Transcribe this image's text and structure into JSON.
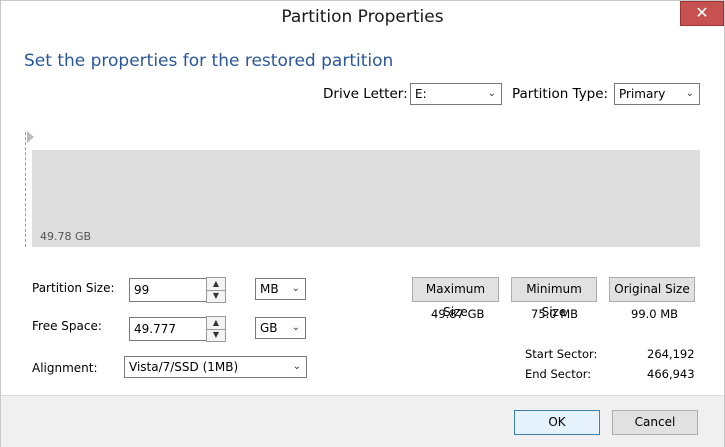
{
  "window": {
    "title": "Partition Properties",
    "close_glyph": "✕"
  },
  "heading": "Set the properties for the restored partition",
  "drive_letter": {
    "label": "Drive Letter:",
    "value": "E:"
  },
  "partition_type": {
    "label": "Partition Type:",
    "value": "Primary"
  },
  "disk_map": {
    "size_label": "49.78 GB"
  },
  "partition_size": {
    "label": "Partition Size:",
    "value": "99",
    "unit": "MB"
  },
  "free_space": {
    "label": "Free Space:",
    "value": "49.777",
    "unit": "GB"
  },
  "alignment": {
    "label": "Alignment:",
    "value": "Vista/7/SSD (1MB)"
  },
  "size_buttons": [
    {
      "label": "Maximum Size",
      "value": "49.87 GB"
    },
    {
      "label": "Minimum Size",
      "value": "75.0 MB"
    },
    {
      "label": "Original Size",
      "value": "99.0 MB"
    }
  ],
  "sectors": {
    "start_label": "Start Sector:",
    "start_value": "264,192",
    "end_label": "End Sector:",
    "end_value": "466,943"
  },
  "footer": {
    "ok_label": "OK",
    "cancel_label": "Cancel"
  },
  "icons": {
    "dropdown": "chevron-down-icon",
    "spin_up": "chevron-up-icon",
    "spin_down": "chevron-down-icon"
  }
}
